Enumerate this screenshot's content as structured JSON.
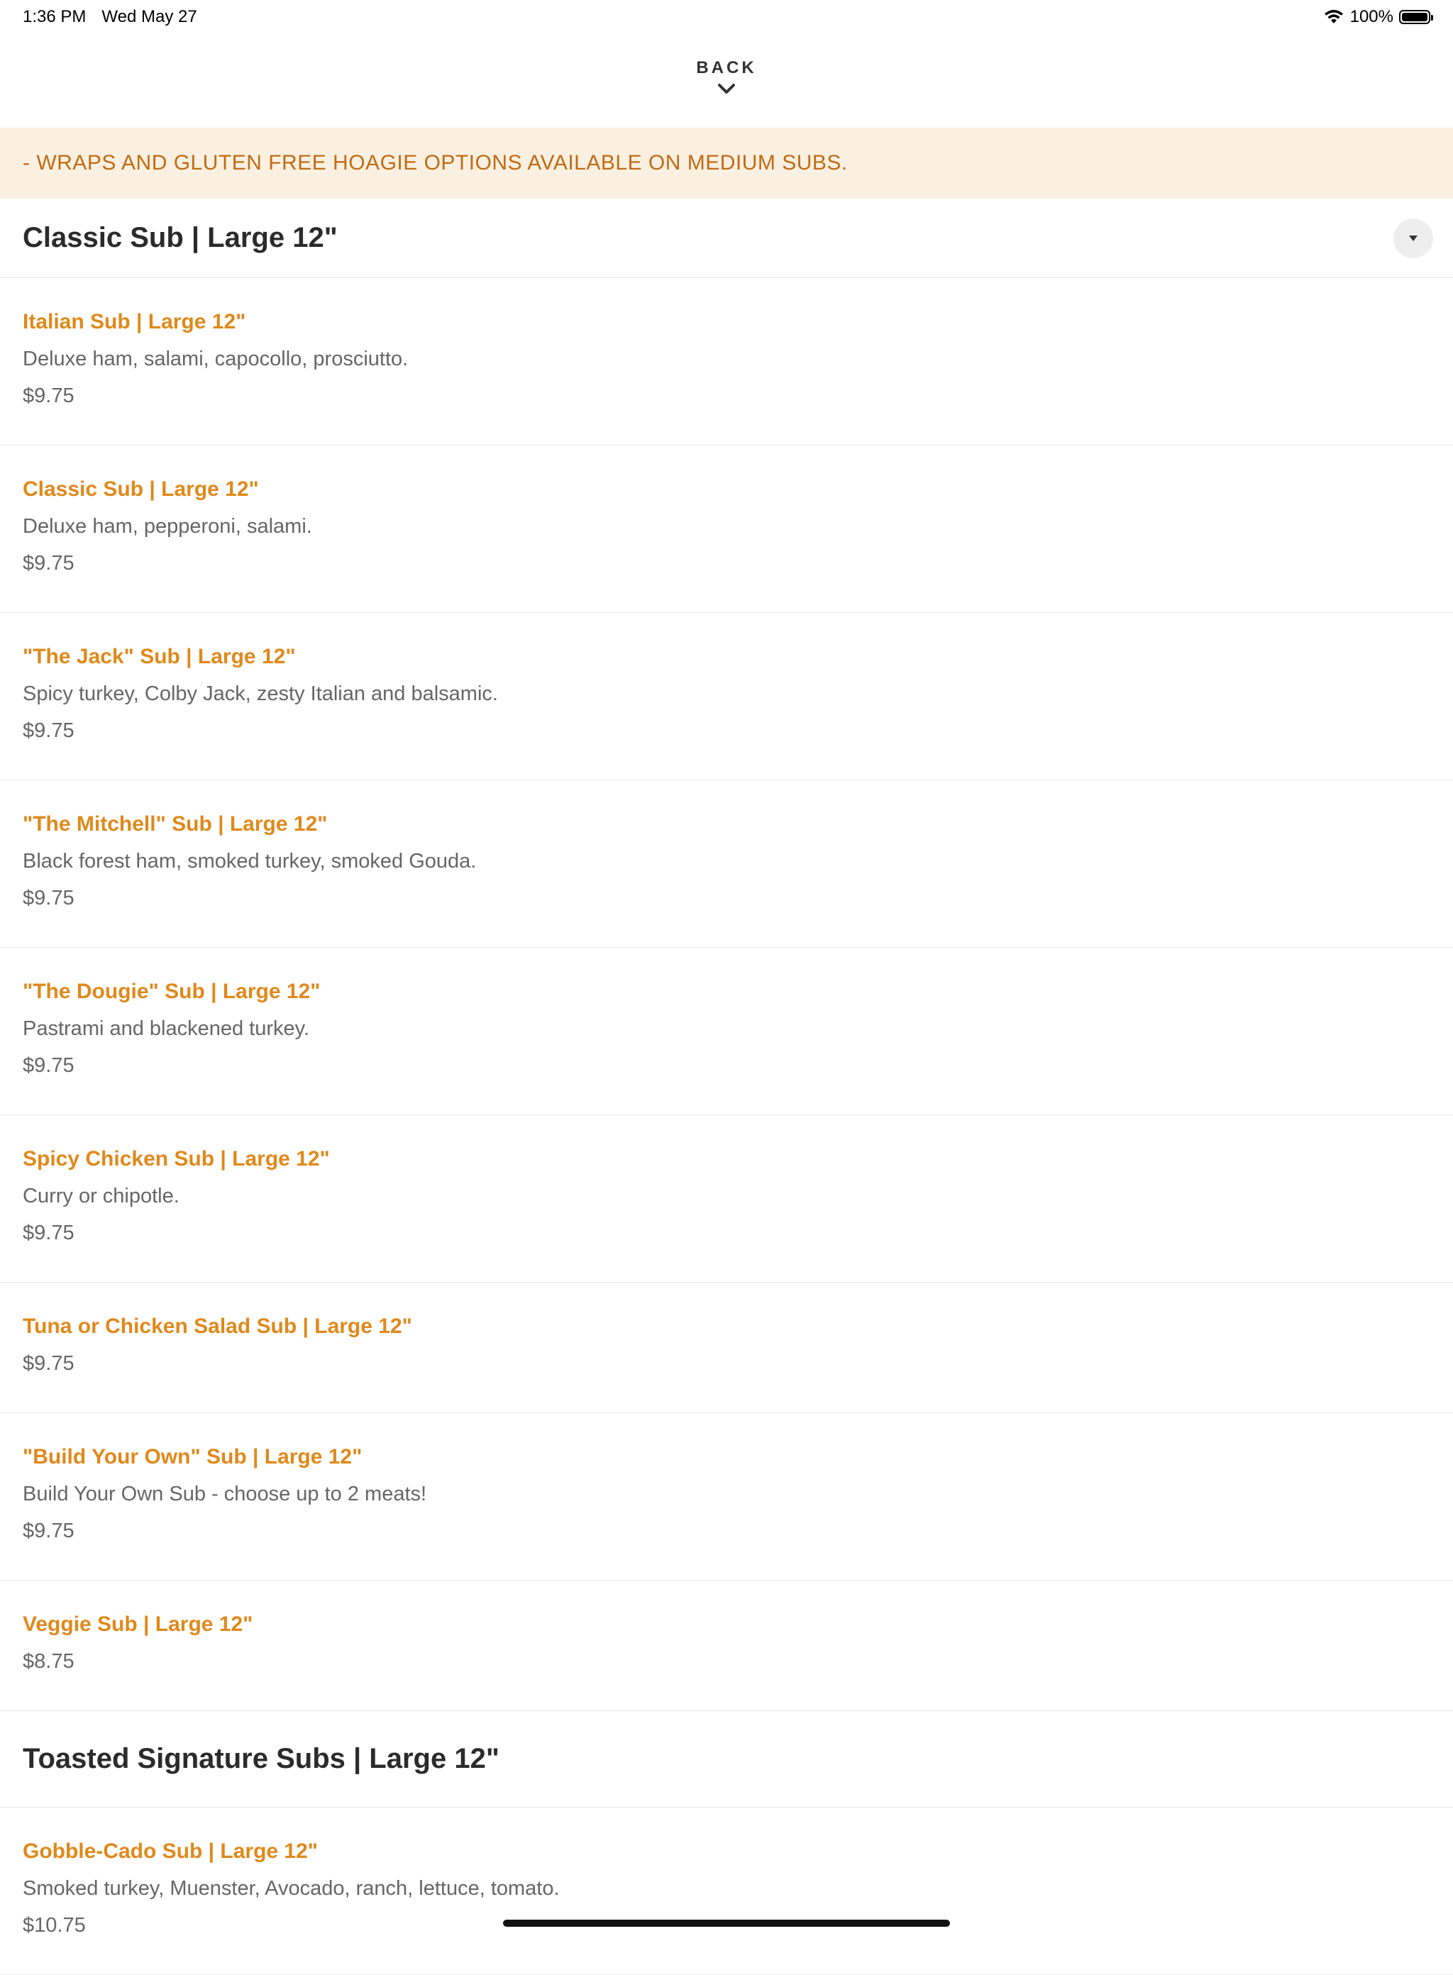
{
  "status_bar": {
    "time": "1:36 PM",
    "date": "Wed May 27",
    "battery": "100%"
  },
  "nav": {
    "back_label": "BACK"
  },
  "banner": {
    "text": "- WRAPS AND GLUTEN FREE HOAGIE OPTIONS AVAILABLE ON MEDIUM SUBS."
  },
  "sections": [
    {
      "title": "Classic Sub | Large 12\"",
      "items": [
        {
          "name": "Italian Sub | Large 12\"",
          "description": "Deluxe ham, salami, capocollo, prosciutto.",
          "price": "$9.75"
        },
        {
          "name": "Classic Sub | Large 12\"",
          "description": "Deluxe ham, pepperoni, salami.",
          "price": "$9.75"
        },
        {
          "name": "\"The Jack\" Sub | Large 12\"",
          "description": "Spicy turkey, Colby Jack, zesty Italian and balsamic.",
          "price": "$9.75"
        },
        {
          "name": "\"The Mitchell\" Sub | Large 12\"",
          "description": "Black forest ham, smoked turkey, smoked Gouda.",
          "price": "$9.75"
        },
        {
          "name": "\"The Dougie\" Sub | Large 12\"",
          "description": "Pastrami and blackened turkey.",
          "price": "$9.75"
        },
        {
          "name": "Spicy Chicken Sub | Large 12\"",
          "description": "Curry or chipotle.",
          "price": "$9.75"
        },
        {
          "name": "Tuna or Chicken Salad Sub | Large 12\"",
          "description": "",
          "price": "$9.75"
        },
        {
          "name": "\"Build Your Own\" Sub | Large 12\"",
          "description": "Build Your Own Sub - choose up to 2 meats!",
          "price": "$9.75"
        },
        {
          "name": "Veggie Sub | Large 12\"",
          "description": "",
          "price": "$8.75"
        }
      ]
    },
    {
      "title": "Toasted Signature Subs | Large 12\"",
      "items": [
        {
          "name": "Gobble-Cado Sub | Large 12\"",
          "description": "Smoked turkey, Muenster, Avocado, ranch, lettuce, tomato.",
          "price": "$10.75"
        }
      ]
    }
  ]
}
